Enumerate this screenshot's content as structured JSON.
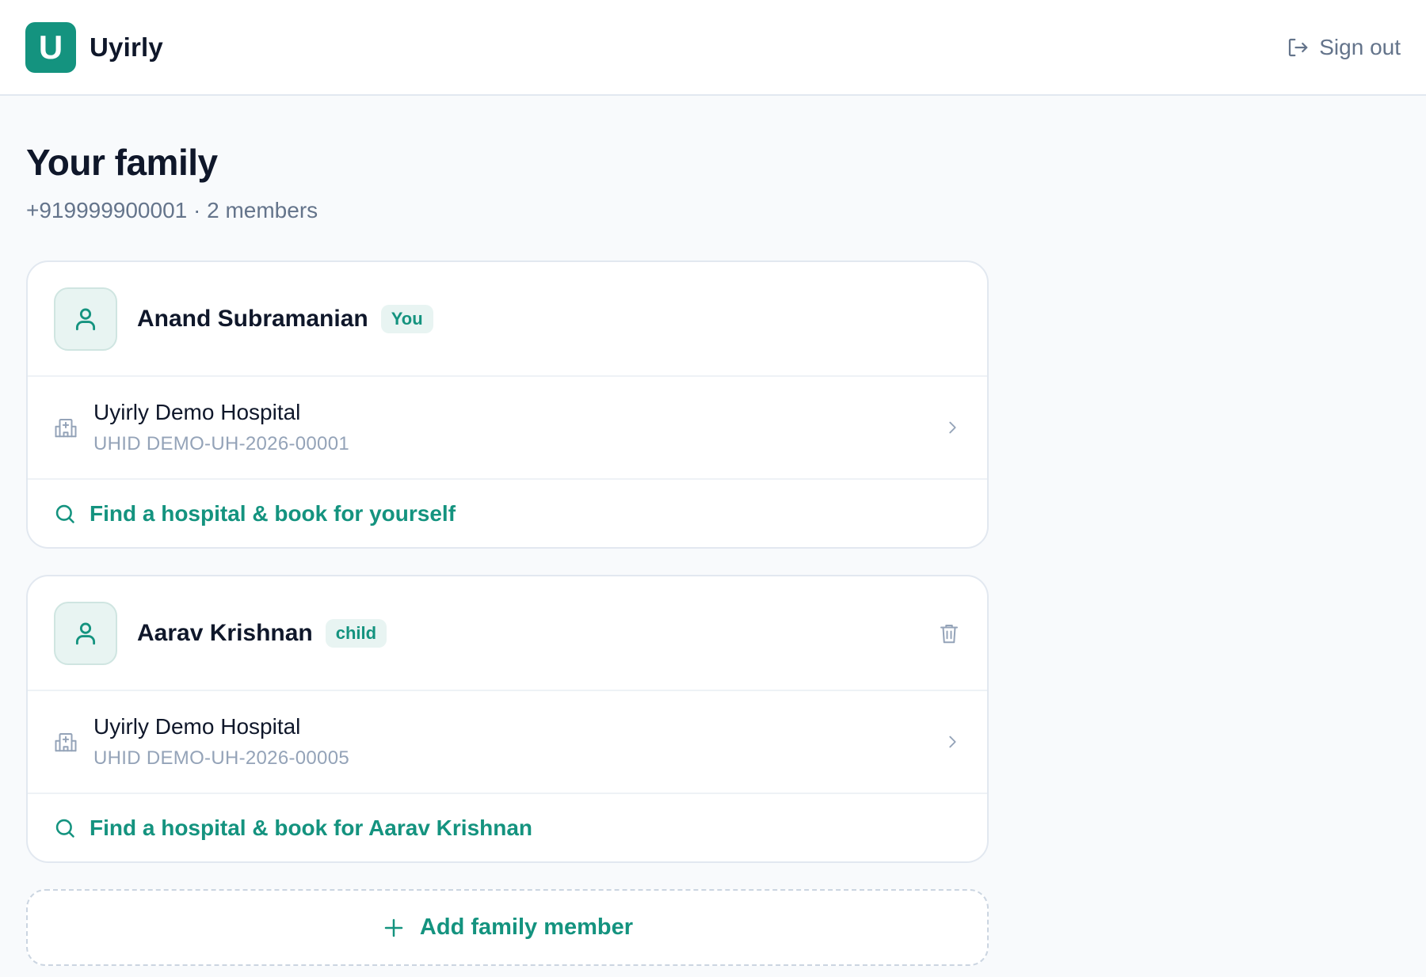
{
  "app": {
    "logo_letter": "U",
    "name": "Uyirly",
    "accent_color": "#14937f"
  },
  "header": {
    "signout_label": "Sign out",
    "signout_icon": "sign-out-icon"
  },
  "page": {
    "title": "Your family",
    "subtitle": "+919999900001 · 2 members"
  },
  "members": [
    {
      "name": "Anand Subramanian",
      "badge": "You",
      "avatar_icon": "user-icon",
      "hospital": {
        "name": "Uyirly Demo Hospital",
        "uhid": "UHID DEMO-UH-2026-00001",
        "icon": "hospital-icon"
      },
      "find_label": "Find a hospital & book for yourself",
      "find_icon": "search-icon"
    },
    {
      "name": "Aarav Krishnan",
      "badge": "child",
      "avatar_icon": "user-icon",
      "delete_icon": "trash-icon",
      "hospital": {
        "name": "Uyirly Demo Hospital",
        "uhid": "UHID DEMO-UH-2026-00005",
        "icon": "hospital-icon"
      },
      "find_label": "Find a hospital & book for Aarav Krishnan",
      "find_icon": "search-icon"
    }
  ],
  "add_member": {
    "label": "Add family member",
    "icon": "plus-icon"
  }
}
